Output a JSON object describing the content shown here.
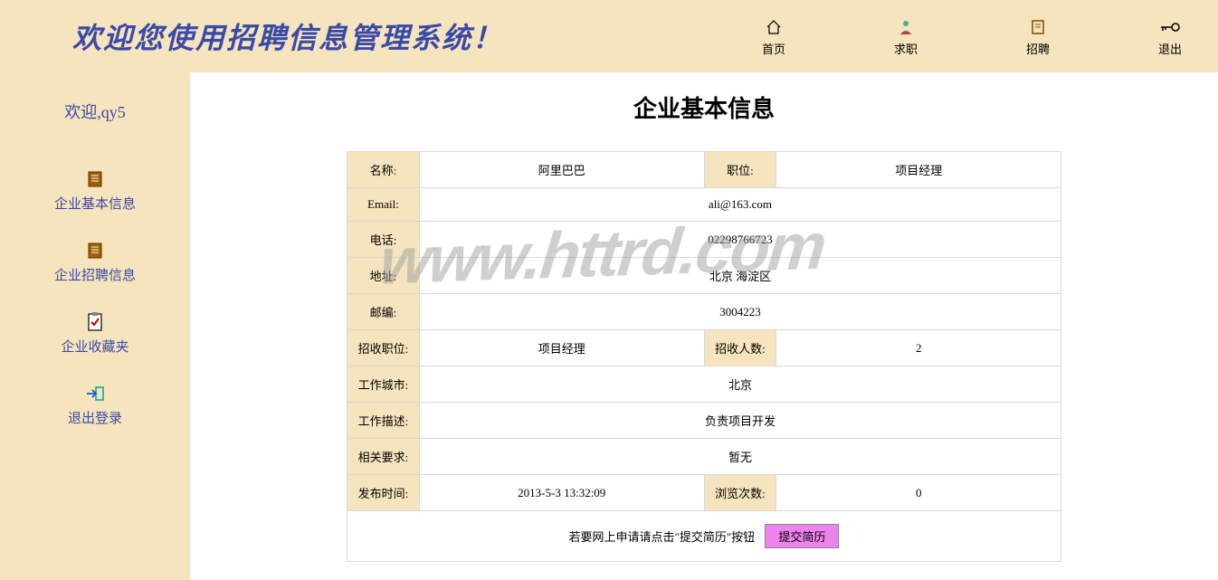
{
  "header": {
    "title": "欢迎您使用招聘信息管理系统！",
    "nav": [
      {
        "label": "首页"
      },
      {
        "label": "求职"
      },
      {
        "label": "招聘"
      },
      {
        "label": "退出"
      }
    ]
  },
  "sidebar": {
    "welcome_prefix": "欢迎,",
    "username": "qy5",
    "items": [
      {
        "label": "企业基本信息"
      },
      {
        "label": "企业招聘信息"
      },
      {
        "label": "企业收藏夹"
      },
      {
        "label": "退出登录"
      }
    ]
  },
  "main": {
    "title": "企业基本信息",
    "rows": {
      "name_label": "名称:",
      "name_value": "阿里巴巴",
      "position_label": "职位:",
      "position_value": "项目经理",
      "email_label": "Email:",
      "email_value": "ali@163.com",
      "phone_label": "电话:",
      "phone_value": "02298766723",
      "address_label": "地址:",
      "address_value": "北京 海淀区",
      "zip_label": "邮编:",
      "zip_value": "3004223",
      "recruit_pos_label": "招收职位:",
      "recruit_pos_value": "项目经理",
      "recruit_num_label": "招收人数:",
      "recruit_num_value": "2",
      "city_label": "工作城市:",
      "city_value": "北京",
      "desc_label": "工作描述:",
      "desc_value": "负责项目开发",
      "req_label": "相关要求:",
      "req_value": "暂无",
      "pub_time_label": "发布时间:",
      "pub_time_value": "2013-5-3 13:32:09",
      "views_label": "浏览次数:",
      "views_value": "0"
    },
    "submit_hint": "若要网上申请请点击\"提交简历\"按钮",
    "submit_btn": "提交简历"
  },
  "watermark": "www.httrd.com"
}
